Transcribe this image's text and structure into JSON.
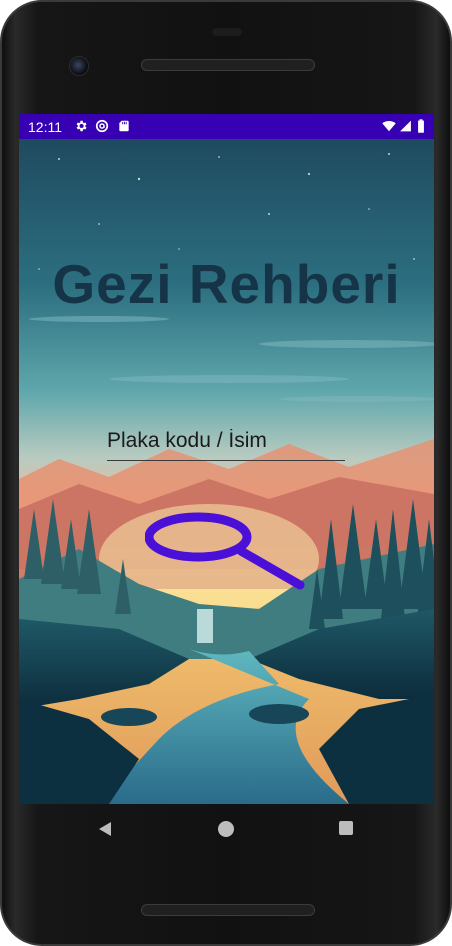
{
  "colors": {
    "statusbar": "#3700b3",
    "title": "#163447",
    "search_icon": "#4a10d8"
  },
  "statusbar": {
    "time": "12:11",
    "left_icons": [
      "gear-icon",
      "at-icon",
      "sdcard-icon"
    ],
    "right_icons": [
      "wifi-icon",
      "signal-icon",
      "battery-icon"
    ]
  },
  "app": {
    "title": "Gezi Rehberi",
    "search_input": {
      "placeholder": "Plaka kodu / İsim",
      "value": ""
    },
    "search_button_icon": "magnifier-icon"
  },
  "navbar": {
    "buttons": [
      "back-icon",
      "home-icon",
      "recents-icon"
    ]
  }
}
